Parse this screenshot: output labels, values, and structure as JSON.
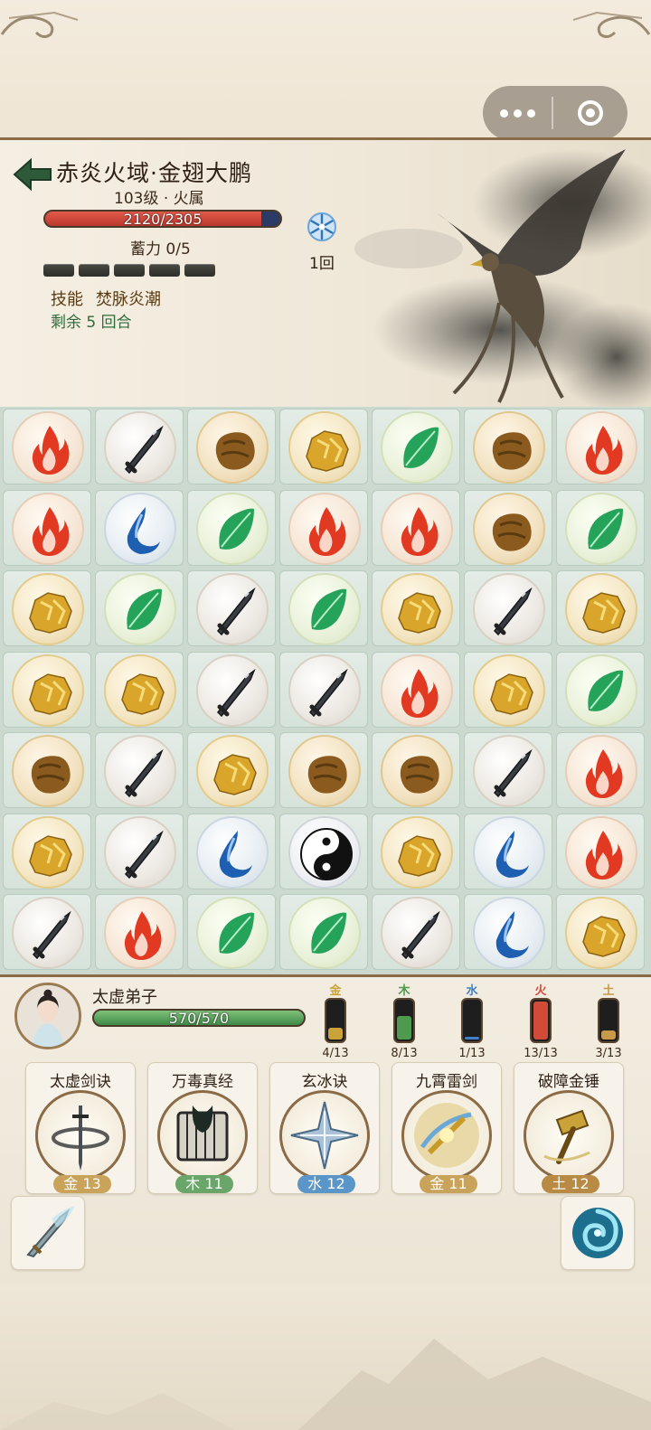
{
  "mini_program_capsule": {
    "more_icon": "more-dots-icon",
    "close_icon": "close-circle-icon"
  },
  "enemy": {
    "name": "赤炎火域·金翅大鹏",
    "level_text": "103级 · 火属",
    "hp_text": "2120/2305",
    "hp_fraction": 0.92,
    "charge_text": "蓄力 0/5",
    "charge_pips": 5,
    "skill_label": "技能",
    "skill_name": "焚脉炎潮",
    "remaining_text": "剩余 5 回合",
    "status_effect": {
      "icon": "snowflake-icon",
      "turns_text": "1回"
    }
  },
  "board": {
    "rows": 7,
    "cols": 7,
    "grid": [
      [
        "fire",
        "metal",
        "earth",
        "gold",
        "wood",
        "earth",
        "fire"
      ],
      [
        "fire",
        "water",
        "wood",
        "fire",
        "fire",
        "earth",
        "wood"
      ],
      [
        "gold",
        "wood",
        "metal",
        "wood",
        "gold",
        "metal",
        "gold"
      ],
      [
        "gold",
        "gold",
        "metal",
        "metal",
        "fire",
        "gold",
        "wood"
      ],
      [
        "earth",
        "metal",
        "gold",
        "earth",
        "earth",
        "metal",
        "fire"
      ],
      [
        "gold",
        "metal",
        "water",
        "taiji",
        "gold",
        "water",
        "fire"
      ],
      [
        "metal",
        "fire",
        "wood",
        "wood",
        "metal",
        "water",
        "gold"
      ]
    ]
  },
  "player": {
    "name": "太虚弟子",
    "hp_text": "570/570",
    "hp_fraction": 1.0,
    "elements": [
      {
        "tag": "金",
        "count": "4/13",
        "fraction": 0.31,
        "color": "#c9a23a"
      },
      {
        "tag": "木",
        "count": "8/13",
        "fraction": 0.62,
        "color": "#4e9a4e"
      },
      {
        "tag": "水",
        "count": "1/13",
        "fraction": 0.08,
        "color": "#3f7fc6"
      },
      {
        "tag": "火",
        "count": "13/13",
        "fraction": 1.0,
        "color": "#d24a38"
      },
      {
        "tag": "土",
        "count": "3/13",
        "fraction": 0.23,
        "color": "#c79a4a"
      }
    ]
  },
  "skills": [
    {
      "name": "太虚剑诀",
      "cost": "金 13",
      "cost_color": "#c9a35a",
      "icon": "sword-vortex-icon"
    },
    {
      "name": "万毒真经",
      "cost": "木 11",
      "cost_color": "#6aa56a",
      "icon": "poison-scroll-icon"
    },
    {
      "name": "玄冰诀",
      "cost": "水 12",
      "cost_color": "#5a96c8",
      "icon": "ice-crystal-icon"
    },
    {
      "name": "九霄雷剑",
      "cost": "金 11",
      "cost_color": "#c9a35a",
      "icon": "thunder-sword-icon"
    },
    {
      "name": "破障金锤",
      "cost": "土 12",
      "cost_color": "#b88a44",
      "icon": "golden-hammer-icon"
    }
  ],
  "items": [
    {
      "icon": "flying-sword-icon"
    },
    {
      "icon": "spirit-vortex-icon"
    }
  ]
}
